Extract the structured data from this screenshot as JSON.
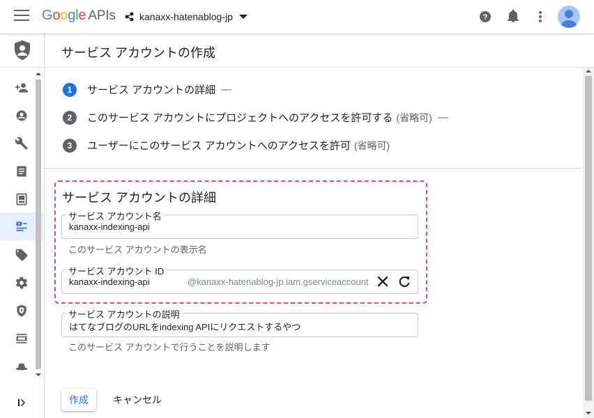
{
  "topbar": {
    "logo_google": "Google",
    "logo_apis": "APIs",
    "project_name": "kanaxx-hatenablog-jp"
  },
  "page": {
    "title": "サービス アカウントの作成"
  },
  "steps": [
    {
      "number": "1",
      "label": "サービス アカウントの詳細",
      "optional": "",
      "dash": "—"
    },
    {
      "number": "2",
      "label": "このサービス アカウントにプロジェクトへのアクセスを許可する",
      "optional": "(省略可)",
      "dash": "—"
    },
    {
      "number": "3",
      "label": "ユーザーにこのサービス アカウントへのアクセスを許可",
      "optional": "(省略可)",
      "dash": ""
    }
  ],
  "details": {
    "section_title": "サービス アカウントの詳細",
    "name_field": {
      "label": "サービス アカウント名",
      "value": "kanaxx-indexing-api",
      "hint": "このサービス アカウントの表示名"
    },
    "id_field": {
      "label": "サービス アカウント ID",
      "value": "kanaxx-indexing-api",
      "suffix": "@kanaxx-hatenablog-jp.iam.gserviceaccount"
    },
    "description_field": {
      "label": "サービス アカウントの説明",
      "value": "はてなブログのURLをindexing APIにリクエストするやつ",
      "hint": "このサービス アカウントで行うことを説明します"
    }
  },
  "actions": {
    "create_label": "作成",
    "cancel_label": "キャンセル"
  },
  "colors": {
    "accent": "#1a73e8",
    "highlight_border": "#e8437a",
    "sidebar_active": "#e8f0fe"
  },
  "icons": {
    "sidebar": [
      "add-person-icon",
      "account-circle-icon",
      "wrench-icon",
      "document-icon",
      "storage-icon",
      "service-account-icon",
      "tag-icon",
      "settings-icon",
      "shield-icon",
      "list-icon",
      "hat-icon"
    ]
  }
}
